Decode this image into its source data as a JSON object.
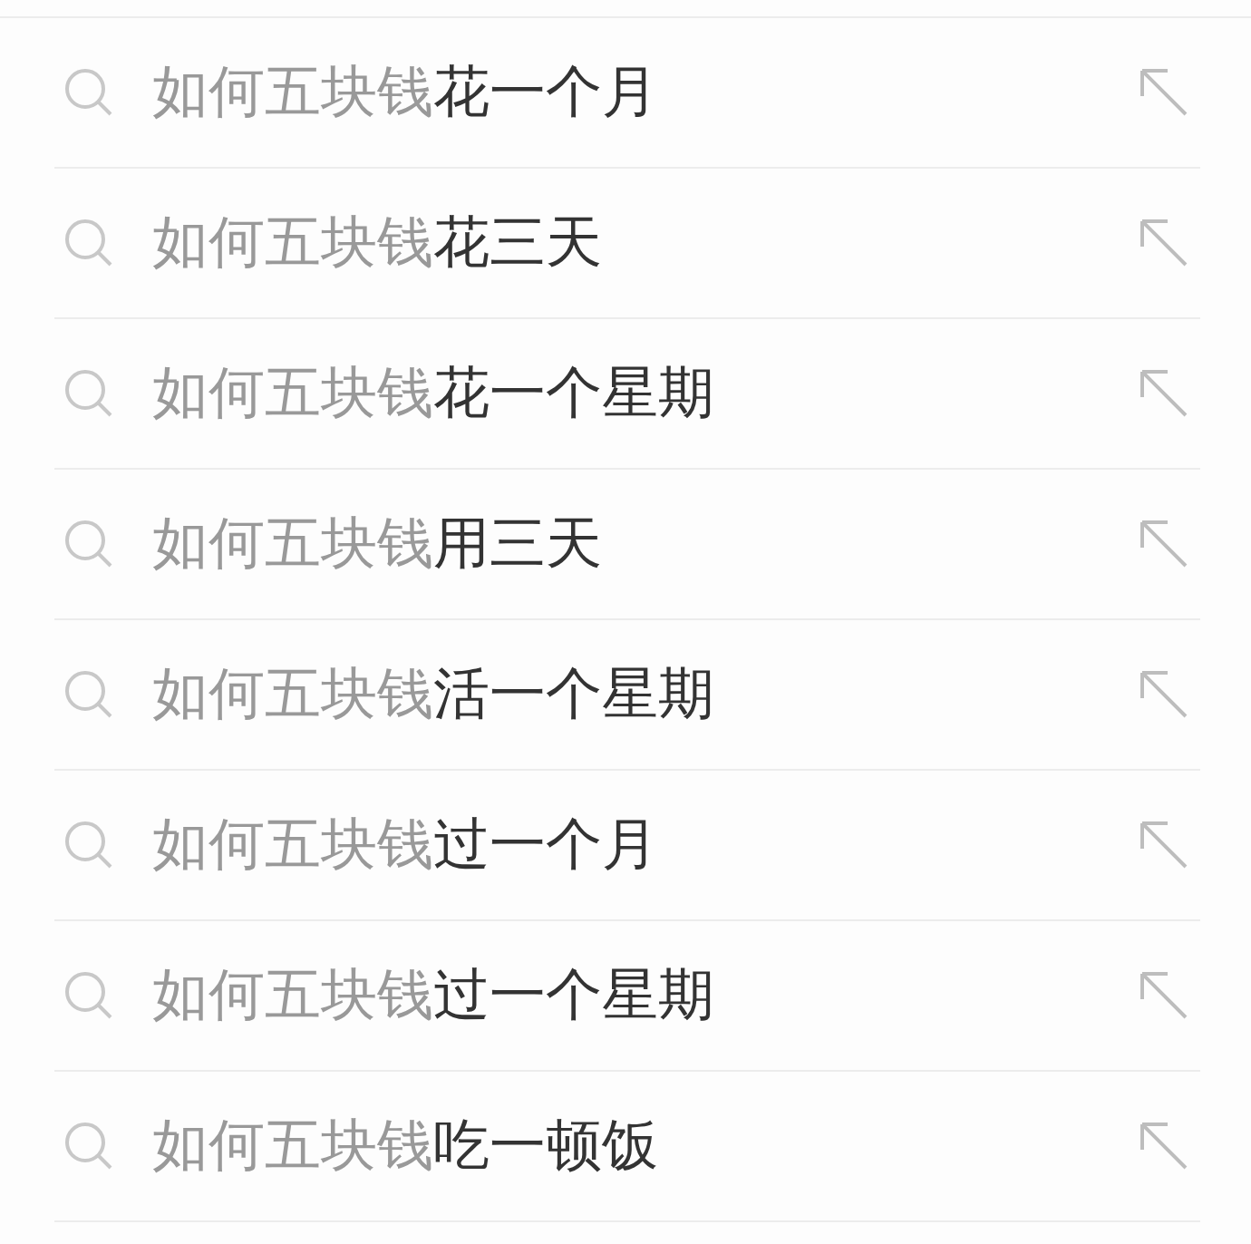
{
  "suggestions": [
    {
      "query": "如何五块钱",
      "completion": "花一个月"
    },
    {
      "query": "如何五块钱",
      "completion": "花三天"
    },
    {
      "query": "如何五块钱",
      "completion": "花一个星期"
    },
    {
      "query": "如何五块钱",
      "completion": "用三天"
    },
    {
      "query": "如何五块钱",
      "completion": "活一个星期"
    },
    {
      "query": "如何五块钱",
      "completion": "过一个月"
    },
    {
      "query": "如何五块钱",
      "completion": "过一个星期"
    },
    {
      "query": "如何五块钱",
      "completion": "吃一顿饭"
    }
  ]
}
